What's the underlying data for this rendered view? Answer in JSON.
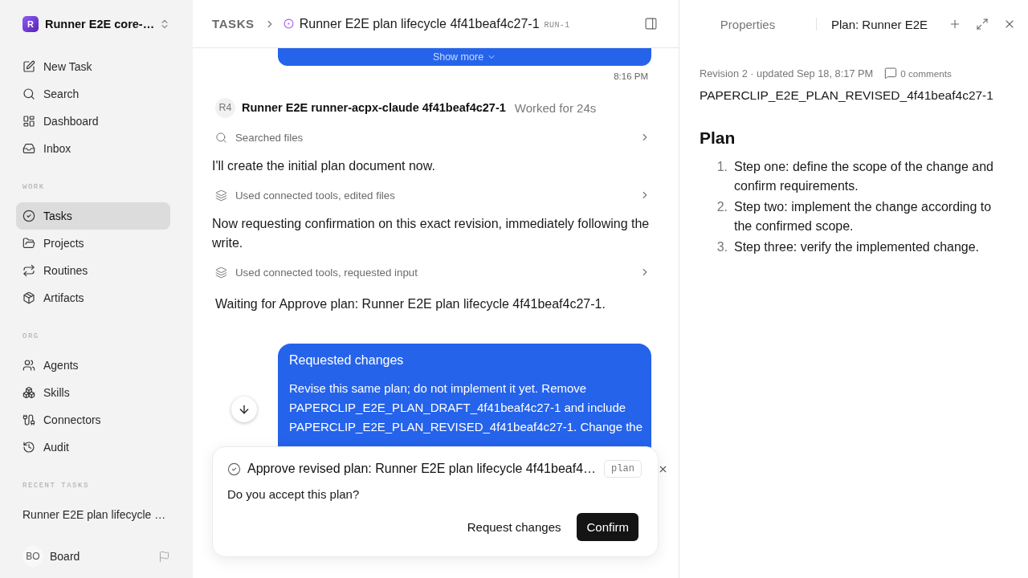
{
  "sidebar": {
    "workspace": {
      "initial": "R",
      "name": "Runner E2E core-…"
    },
    "nav": [
      {
        "label": "New Task",
        "selected": false
      },
      {
        "label": "Search",
        "selected": false
      },
      {
        "label": "Dashboard",
        "selected": false
      },
      {
        "label": "Inbox",
        "selected": false
      }
    ],
    "sections": [
      {
        "title": "WORK",
        "items": [
          {
            "label": "Tasks",
            "selected": true
          },
          {
            "label": "Projects",
            "selected": false
          },
          {
            "label": "Routines",
            "selected": false
          },
          {
            "label": "Artifacts",
            "selected": false
          }
        ]
      },
      {
        "title": "ORG",
        "items": [
          {
            "label": "Agents",
            "selected": false
          },
          {
            "label": "Skills",
            "selected": false
          },
          {
            "label": "Connectors",
            "selected": false
          },
          {
            "label": "Audit",
            "selected": false
          }
        ]
      }
    ],
    "recent": {
      "title": "RECENT TASKS",
      "items": [
        {
          "label": "Runner E2E plan lifecycle …",
          "selected": false
        }
      ]
    },
    "user": {
      "initials": "BO",
      "name": "Board"
    }
  },
  "task": {
    "breadcrumb": "TASKS",
    "title": "Runner E2E plan lifecycle 4f41beaf4c27-1",
    "run": "RUN-1"
  },
  "feed": [
    {
      "kind": "user_message",
      "show_more": "Show more",
      "time": "8:16 PM"
    },
    {
      "kind": "agent_header",
      "avatar": "R4",
      "name": "Runner E2E runner-acpx-claude 4f41beaf4c27-1",
      "status": "Worked for 24s"
    },
    {
      "kind": "search",
      "label": "Searched files"
    },
    {
      "kind": "text",
      "text": "I'll create the initial plan document now."
    },
    {
      "kind": "tools",
      "label": "Used connected tools, edited files"
    },
    {
      "kind": "text",
      "text": "Now requesting confirmation on this exact revision, immediately following the write."
    },
    {
      "kind": "tools",
      "label": "Used connected tools, requested input"
    },
    {
      "kind": "status",
      "text": "Waiting for Approve plan: Runner E2E plan lifecycle 4f41beaf4c27-1."
    },
    {
      "kind": "user_message",
      "title": "Requested changes",
      "body": "Revise this same plan; do not implement it yet. Remove PAPERCLIP_E2E_PLAN_DRAFT_4f41beaf4c27-1 and include PAPERCLIP_E2E_PLAN_REVISED_4f41beaf4c27-1. Change the"
    }
  ],
  "approval": {
    "title": "Approve revised plan: Runner E2E plan lifecycle 4f41beaf4…",
    "tag": "plan",
    "question": "Do you accept this plan?",
    "buttons": [
      {
        "label": "Request changes",
        "kind": "secondary"
      },
      {
        "label": "Confirm",
        "kind": "primary"
      }
    ]
  },
  "panel": {
    "tabs": [
      {
        "label": "Properties",
        "selected": false
      },
      {
        "label": "Plan: Runner E2E",
        "selected": true
      }
    ],
    "meta": "Revision 2 · updated Sep 18, 8:17 PM",
    "comments": "0 comments",
    "marker": "PAPERCLIP_E2E_PLAN_REVISED_4f41beaf4c27-1",
    "heading": "Plan",
    "steps": [
      {
        "number": "1.",
        "text": "Step one: define the scope of the change and confirm requirements."
      },
      {
        "number": "2.",
        "text": "Step two: implement the change according to the confirmed scope."
      },
      {
        "number": "3.",
        "text": "Step three: verify the implemented change."
      }
    ]
  }
}
